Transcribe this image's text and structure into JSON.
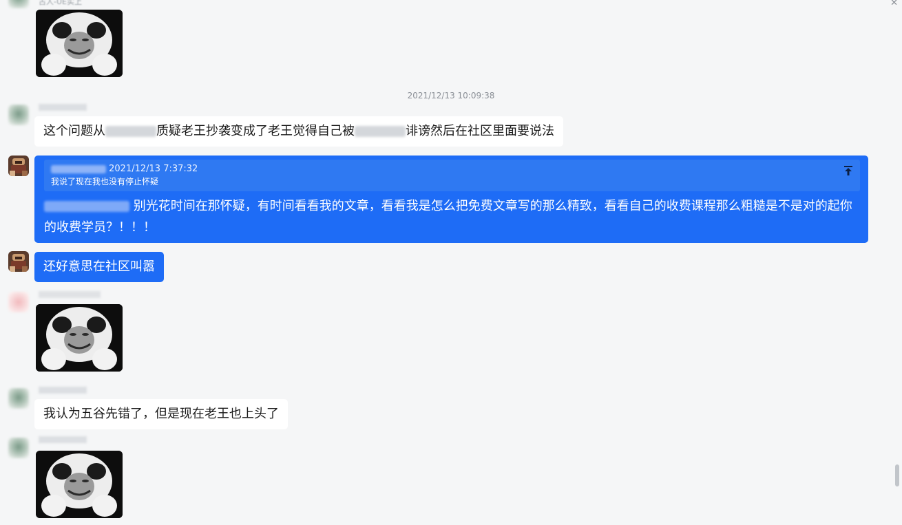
{
  "chat": {
    "top_sender": "古人-UE实上",
    "timestamp": "2021/12/13 10:09:38",
    "messages": [
      {
        "id": "m1",
        "text_before": "这个问题从",
        "text_middle": "质疑老王抄袭变成了老王觉得自己被",
        "text_after": "诽谤然后在社区里面要说法"
      },
      {
        "id": "m2",
        "quote_time": "2021/12/13 7:37:32",
        "quote_text": "我说了现在我也没有停止怀疑",
        "reply_text": "别光花时间在那怀疑，有时间看看我的文章，看看我是怎么把免费文章写的那么精致，看看自己的收费课程那么粗糙是不是对的起你的收费学员？！！！"
      },
      {
        "id": "m3",
        "text": "还好意思在社区叫嚣"
      },
      {
        "id": "m5",
        "text": "我认为五谷先错了，但是现在老王也上头了"
      }
    ]
  },
  "icons": {
    "jump": "jump-to-original-icon",
    "close": "close-icon"
  },
  "colors": {
    "background": "#f5f6f7",
    "self_bubble": "#1e6cf6",
    "other_bubble": "#ffffff"
  }
}
